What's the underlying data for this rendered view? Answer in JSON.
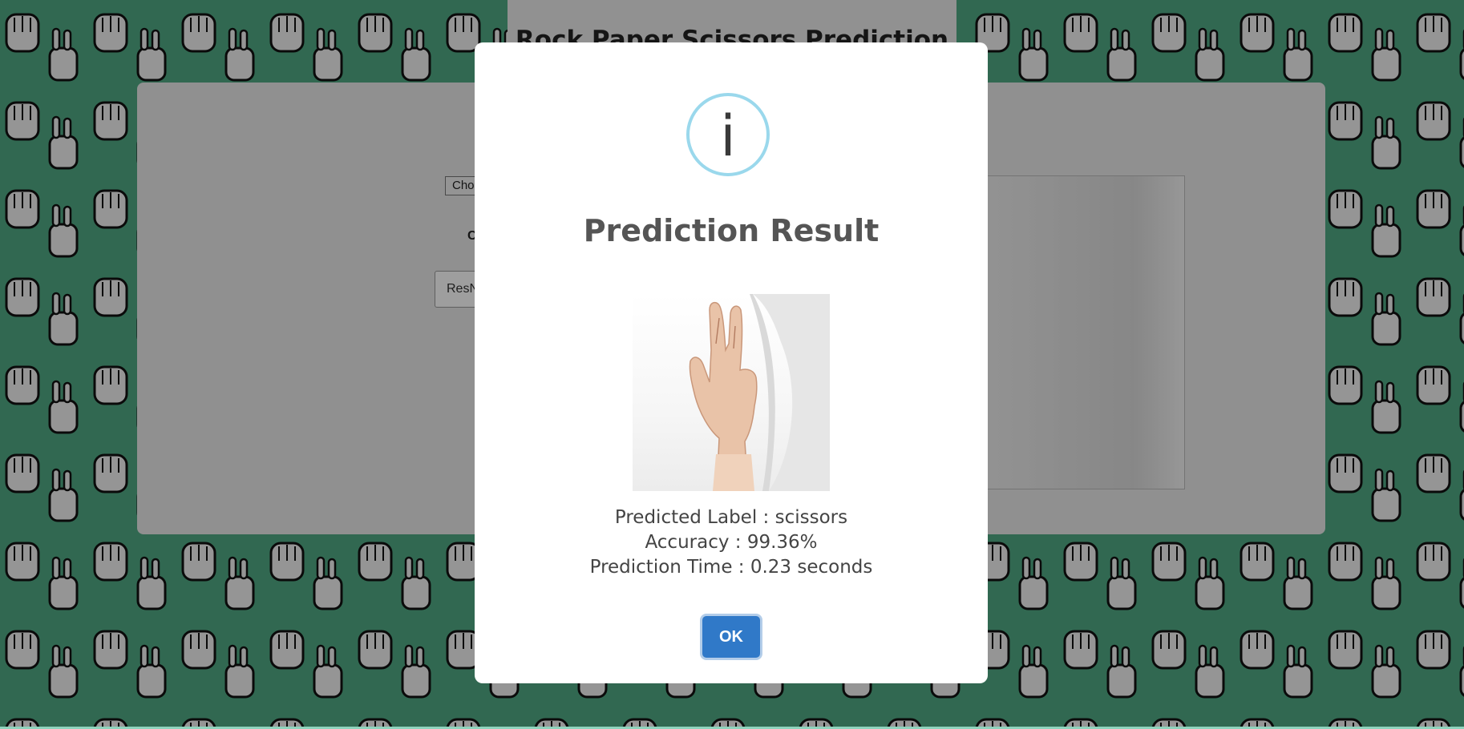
{
  "app": {
    "title": "Rock Paper Scissors Prediction",
    "file_button_label": "Cho",
    "choose_label": "C",
    "model_select_value": "ResN"
  },
  "modal": {
    "icon": "info-icon",
    "icon_glyph": "i",
    "title": "Prediction Result",
    "image": "scissors-hand-image",
    "predicted_label_line": "Predicted Label : scissors",
    "accuracy_line": "Accuracy : 99.36%",
    "prediction_time_line": "Prediction Time : 0.23 seconds",
    "ok_label": "OK"
  },
  "colors": {
    "background_green": "#4fa884",
    "overlay": "rgba(0,0,0,0.38)",
    "icon_ring": "#9ad8ec",
    "ok_button": "#3079c8"
  }
}
